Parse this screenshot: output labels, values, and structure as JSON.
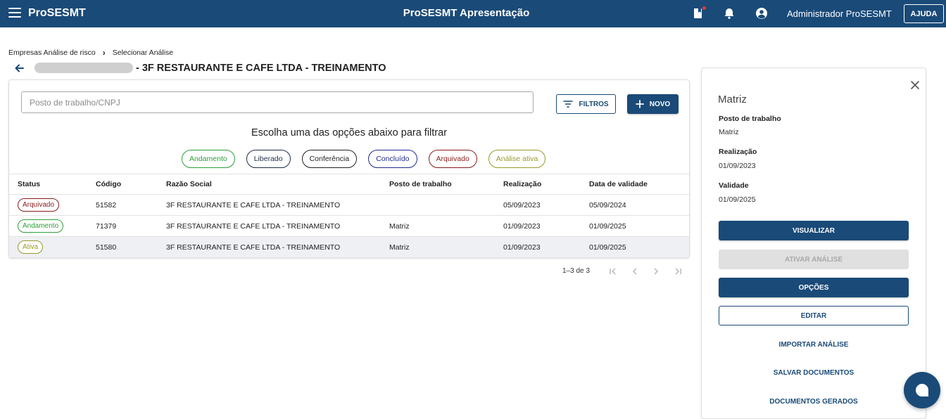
{
  "header": {
    "brand": "ProSESMT",
    "title": "ProSESMT Apresentação",
    "user_name": "Administrador ProSESMT",
    "help_label": "AJUDA",
    "icons": [
      "menu-icon",
      "book-icon",
      "bell-icon",
      "account-circle-icon"
    ],
    "accent_color": "#1a4a78",
    "notification_dot_color": "#e53935"
  },
  "breadcrumb": {
    "items": [
      "Empresas Análise de risco",
      "Selecionar Análise"
    ],
    "separator": "›"
  },
  "page": {
    "title": "- 3F RESTAURANTE E CAFE LTDA - TREINAMENTO"
  },
  "search": {
    "placeholder": "Posto de trabalho/CNPJ",
    "value": ""
  },
  "toolbar": {
    "filters_label": "FILTROS",
    "new_label": "NOVO"
  },
  "filter_section": {
    "heading": "Escolha uma das opções abaixo para filtrar",
    "chips": [
      {
        "label": "Andamento",
        "color": "#2e9e3a"
      },
      {
        "label": "Liberado",
        "color": "#1c2f4a"
      },
      {
        "label": "Conferência",
        "color": "#222222"
      },
      {
        "label": "Concluído",
        "color": "#1f2a8c"
      },
      {
        "label": "Arquivado",
        "color": "#8a1c1c"
      },
      {
        "label": "Análise ativa",
        "color": "#9a9a2a"
      }
    ]
  },
  "table": {
    "columns": [
      "Status",
      "Código",
      "Razão Social",
      "Posto de trabalho",
      "Realização",
      "Data de validade"
    ],
    "rows": [
      {
        "status": "Arquivado",
        "status_color": "#8a1c1c",
        "code": "51582",
        "company": "3F RESTAURANTE E CAFE LTDA - TREINAMENTO",
        "workstation": "",
        "done": "05/09/2023",
        "valid": "05/09/2024"
      },
      {
        "status": "Andamento",
        "status_color": "#2e9e3a",
        "code": "71379",
        "company": "3F RESTAURANTE E CAFE LTDA - TREINAMENTO",
        "workstation": "Matriz",
        "done": "01/09/2023",
        "valid": "01/09/2025"
      },
      {
        "status": "Ativa",
        "status_color": "#9a9a2a",
        "code": "51580",
        "company": "3F RESTAURANTE E CAFE LTDA - TREINAMENTO",
        "workstation": "Matriz",
        "done": "01/09/2023",
        "valid": "01/09/2025"
      }
    ]
  },
  "pagination": {
    "range": "1–3 de 3"
  },
  "side_panel": {
    "title": "Matriz",
    "workstation_label": "Posto de trabalho",
    "workstation_value": "Matriz",
    "done_label": "Realização",
    "done_value": "01/09/2023",
    "valid_label": "Validade",
    "valid_value": "01/09/2025",
    "view_label": "VISUALIZAR",
    "activate_label": "ATIVAR ANÁLISE",
    "options_label": "OPÇÕES",
    "edit_label": "EDITAR",
    "import_label": "IMPORTAR ANÁLISE",
    "save_docs_label": "SALVAR DOCUMENTOS",
    "generated_docs_label": "DOCUMENTOS GERADOS"
  }
}
